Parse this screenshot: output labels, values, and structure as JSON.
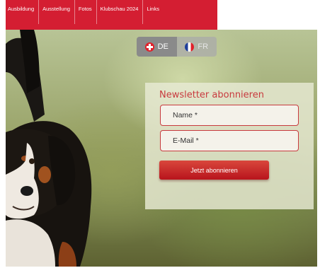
{
  "nav": {
    "items": [
      "Ausbildung",
      "Ausstellung",
      "Fotos",
      "Klubschau 2024",
      "Links"
    ],
    "color": "#d41e32"
  },
  "language": {
    "de_label": "DE",
    "fr_label": "FR",
    "active": "DE"
  },
  "newsletter": {
    "title": "Newsletter abonnieren",
    "name_placeholder": "Name *",
    "email_placeholder": "E-Mail *",
    "submit_label": "Jetzt abonnieren",
    "accent": "#c83a3e"
  }
}
